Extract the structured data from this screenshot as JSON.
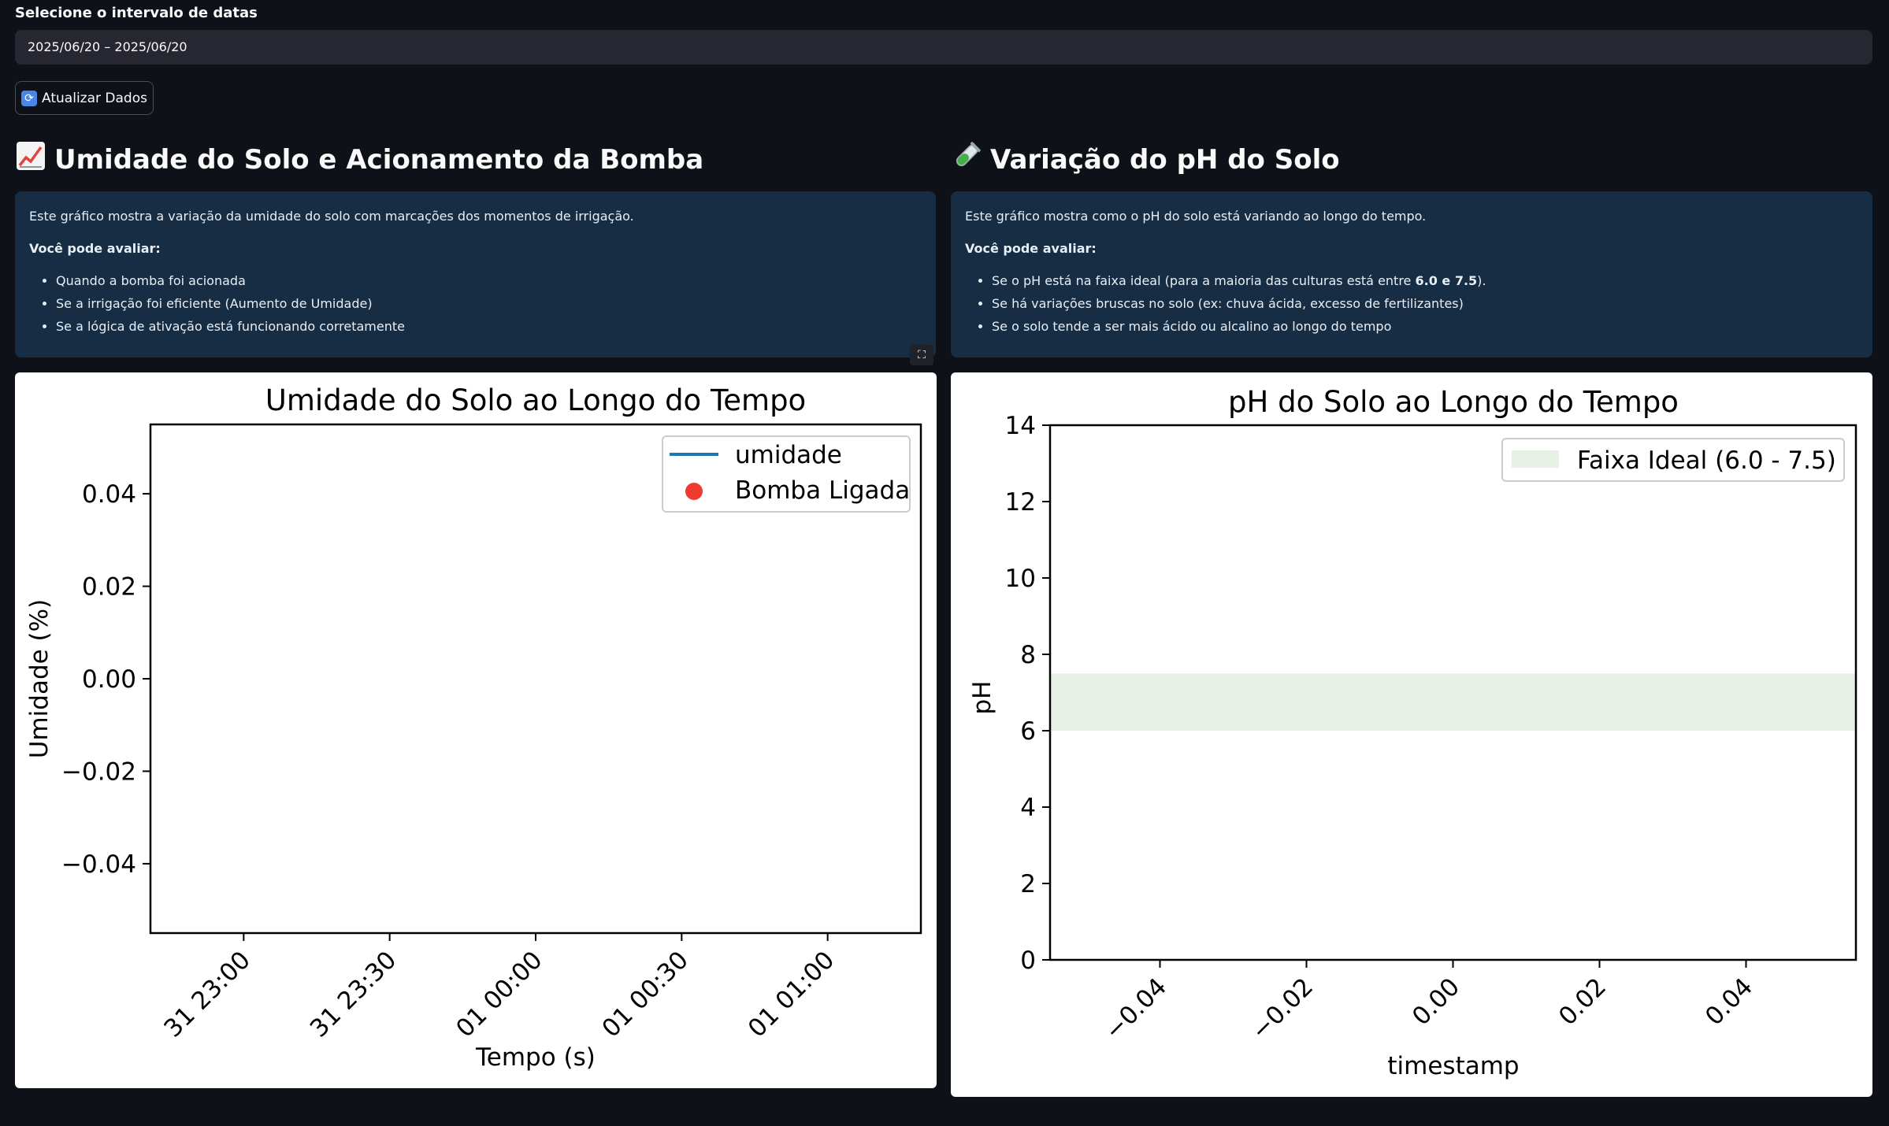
{
  "date_range": {
    "label": "Selecione o intervalo de datas",
    "value": "2025/06/20 – 2025/06/20"
  },
  "refresh_button": {
    "icon": "refresh-icon",
    "label": "Atualizar Dados"
  },
  "left_section": {
    "icon": "chart-increasing-icon",
    "title": "Umidade do Solo e Acionamento da Bomba",
    "intro": "Este gráfico mostra a variação da umidade do solo com marcações dos momentos de irrigação.",
    "can_evaluate": "Você pode avaliar:",
    "items": [
      "Quando a bomba foi acionada",
      "Se a irrigação foi eficiente (Aumento de Umidade)",
      "Se a lógica de ativação está funcionando corretamente"
    ]
  },
  "right_section": {
    "icon": "test-tube-icon",
    "title": "Variação do pH do Solo",
    "intro": "Este gráfico mostra como o pH do solo está variando ao longo do tempo.",
    "can_evaluate": "Você pode avaliar:",
    "item1_prefix": "Se o pH está na faixa ideal (para a maioria das culturas está entre ",
    "item1_bold": "6.0 e 7.5",
    "item1_suffix": ").",
    "items": [
      "Se há variações bruscas no solo (ex: chuva ácida, excesso de fertilizantes)",
      "Se o solo tende a ser mais ácido ou alcalino ao longo do tempo"
    ]
  },
  "colors": {
    "background": "#0e1117",
    "info_box": "#172d43",
    "line_series": "#1f77b4",
    "pump_marker": "#ef3a2f",
    "ideal_band": "#e6f0e5"
  },
  "chart_data": [
    {
      "type": "line",
      "title": "Umidade do Solo ao Longo do Tempo",
      "xlabel": "Tempo (s)",
      "ylabel": "Umidade (%)",
      "x_ticks": [
        "31 23:00",
        "31 23:30",
        "01 00:00",
        "01 00:30",
        "01 01:00"
      ],
      "y_ticks": [
        "0.04",
        "0.02",
        "0.00",
        "−0.02",
        "−0.04"
      ],
      "ylim": [
        -0.055,
        0.055
      ],
      "series": [
        {
          "name": "umidade",
          "values": []
        },
        {
          "name": "Bomba Ligada",
          "values": []
        }
      ],
      "legend": "top-right",
      "grid": false
    },
    {
      "type": "line",
      "title": "pH do Solo ao Longo do Tempo",
      "xlabel": "timestamp",
      "ylabel": "pH",
      "x_ticks": [
        "−0.04",
        "−0.02",
        "0.00",
        "0.02",
        "0.04"
      ],
      "y_ticks": [
        "14",
        "12",
        "10",
        "8",
        "6",
        "4",
        "2",
        "0"
      ],
      "ylim": [
        0,
        14
      ],
      "xlim": [
        -0.055,
        0.055
      ],
      "ideal_band": {
        "name": "Faixa Ideal (6.0 - 7.5)",
        "low": 6.0,
        "high": 7.5
      },
      "series": [],
      "legend": "top-right",
      "grid": false
    }
  ]
}
